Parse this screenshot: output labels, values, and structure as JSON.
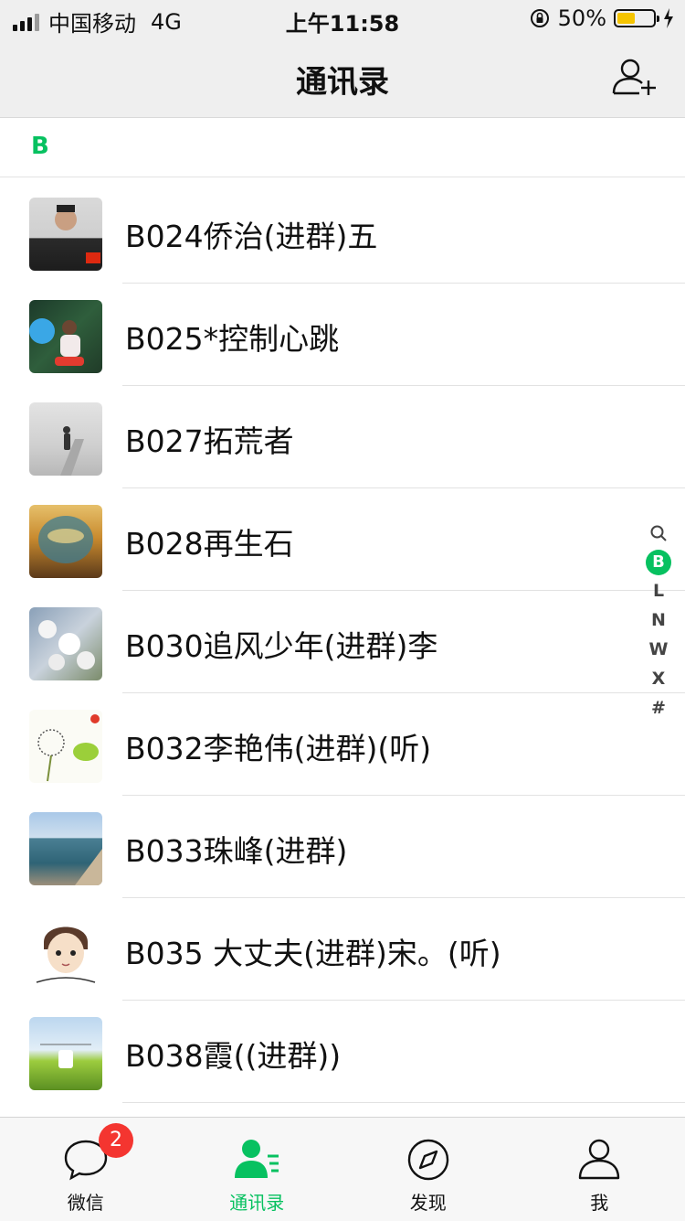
{
  "status_bar": {
    "carrier": "中国移动",
    "network": "4G",
    "time": "上午11:58",
    "battery_percent": "50%",
    "battery_level": 0.5
  },
  "nav": {
    "title": "通讯录",
    "add_icon": "add-contact-icon"
  },
  "section": {
    "letter": "B"
  },
  "contacts": [
    {
      "name": "B024侨治(进群)五"
    },
    {
      "name": "B025*控制心跳"
    },
    {
      "name": "B027拓荒者"
    },
    {
      "name": "B028再生石"
    },
    {
      "name": "B030追风少年(进群)李"
    },
    {
      "name": "B032李艳伟(进群)(听)"
    },
    {
      "name": "B033珠峰(进群)"
    },
    {
      "name": "B035 大丈夫(进群)宋。(听)"
    },
    {
      "name": "B038霞((进群))"
    }
  ],
  "index": {
    "search_icon": "search-icon",
    "letters": [
      "B",
      "L",
      "N",
      "W",
      "X",
      "#"
    ],
    "active": "B"
  },
  "tabs": [
    {
      "label": "微信",
      "icon": "chat-bubble-icon",
      "badge": "2"
    },
    {
      "label": "通讯录",
      "icon": "contacts-icon",
      "active": true
    },
    {
      "label": "发现",
      "icon": "compass-icon"
    },
    {
      "label": "我",
      "icon": "profile-icon"
    }
  ],
  "colors": {
    "accent": "#07c160",
    "badge": "#f43530",
    "battery": "#f5c400"
  }
}
